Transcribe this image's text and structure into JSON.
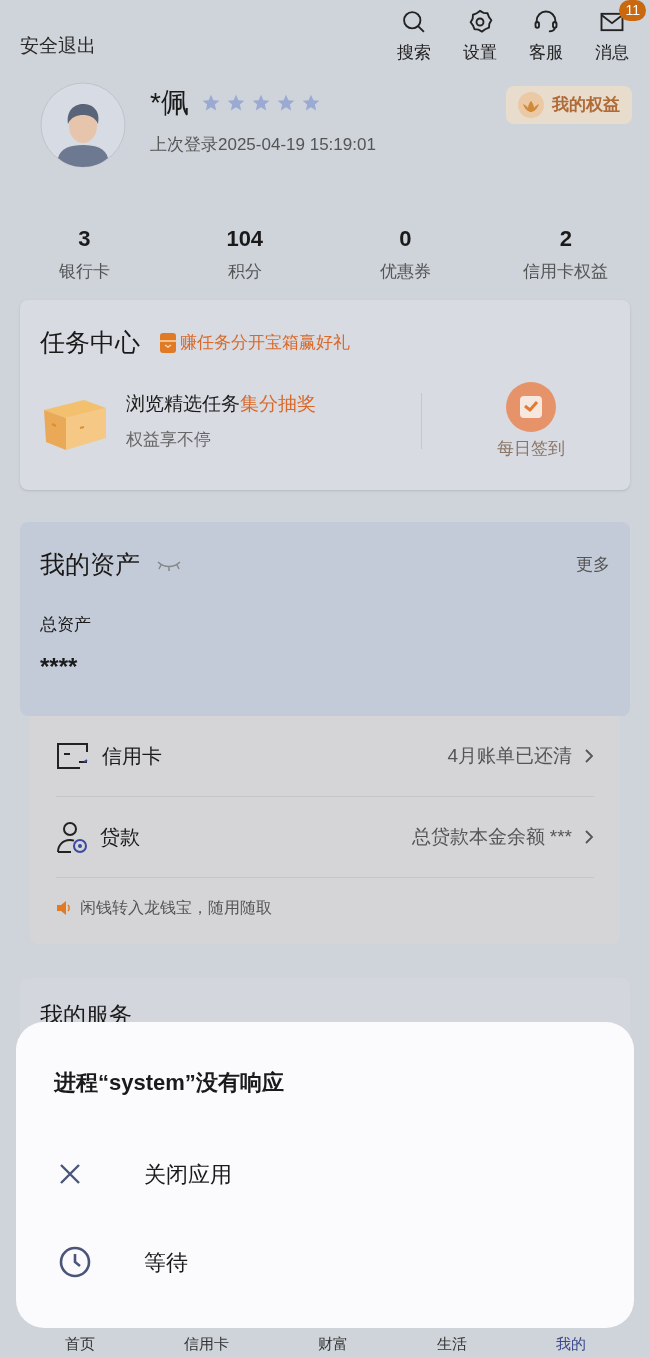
{
  "header": {
    "exit": "安全退出",
    "actions": [
      {
        "kind": "search",
        "label": "搜索"
      },
      {
        "kind": "settings",
        "label": "设置"
      },
      {
        "kind": "service",
        "label": "客服"
      },
      {
        "kind": "message",
        "label": "消息",
        "badge": "11"
      }
    ]
  },
  "profile": {
    "name": "*佩",
    "stars": 5,
    "last_login": "上次登录2025-04-19 15:19:01",
    "rights_button": "我的权益"
  },
  "stats": [
    {
      "value": "3",
      "label": "银行卡"
    },
    {
      "value": "104",
      "label": "积分"
    },
    {
      "value": "0",
      "label": "优惠券"
    },
    {
      "value": "2",
      "label": "信用卡权益"
    }
  ],
  "task_center": {
    "title": "任务中心",
    "promo": "赚任务分开宝箱赢好礼",
    "task_title": "浏览精选任务",
    "task_highlight": "集分抽奖",
    "task_subtitle": "权益享不停",
    "checkin": "每日签到"
  },
  "assets": {
    "title": "我的资产",
    "more": "更多",
    "total_label": "总资产",
    "total_value": "****",
    "rows": [
      {
        "kind": "card",
        "label": "信用卡",
        "value": "4月账单已还清"
      },
      {
        "kind": "loan",
        "label": "贷款",
        "value": "总贷款本金余额 ***"
      }
    ],
    "notice": "闲钱转入龙钱宝，随用随取"
  },
  "services": {
    "title": "我的服务"
  },
  "dialog": {
    "title": "进程“system”没有响应",
    "options": [
      {
        "kind": "close",
        "label": "关闭应用"
      },
      {
        "kind": "wait",
        "label": "等待"
      }
    ]
  },
  "nav": [
    {
      "label": "首页",
      "selected": false
    },
    {
      "label": "信用卡",
      "selected": false
    },
    {
      "label": "财富",
      "selected": false
    },
    {
      "label": "生活",
      "selected": false
    },
    {
      "label": "我的",
      "selected": true
    }
  ]
}
